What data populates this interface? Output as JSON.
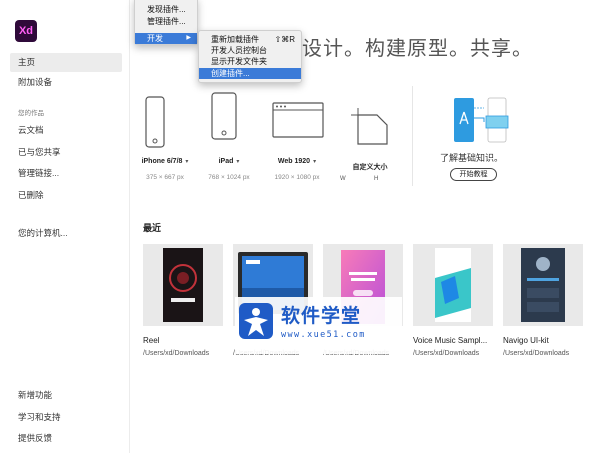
{
  "app": {
    "logo_text": "Xd",
    "logo_bg": "#2f0a3a",
    "logo_fg": "#ff61f6"
  },
  "sidebar": {
    "items": [
      {
        "label": "主页"
      },
      {
        "label": "附加设备"
      }
    ],
    "section_title": "您的作品",
    "work_items": [
      {
        "label": "云文档"
      },
      {
        "label": "已与您共享"
      },
      {
        "label": "管理链接..."
      },
      {
        "label": "已删除"
      }
    ],
    "computer_item": {
      "label": "您的计算机..."
    },
    "bottom_items": [
      {
        "label": "新增功能"
      },
      {
        "label": "学习和支持"
      },
      {
        "label": "提供反馈"
      }
    ]
  },
  "hero": {
    "title_visible": "设计。构建原型。共享。"
  },
  "templates": [
    {
      "label": "iPhone 6/7/8",
      "dims": "375 × 667 px",
      "icon": "phone-icon"
    },
    {
      "label": "iPad",
      "dims": "768 × 1024 px",
      "icon": "tablet-icon"
    },
    {
      "label": "Web 1920",
      "dims": "1920 × 1080 px",
      "icon": "browser-window-icon"
    },
    {
      "label": "自定义大小",
      "w_label": "W",
      "h_label": "H",
      "icon": "custom-size-icon"
    }
  ],
  "learn": {
    "caption": "了解基础知识。",
    "button": "开始教程"
  },
  "recent": {
    "title": "最近",
    "items": [
      {
        "name": "Reel",
        "path": "/Users/xd/Downloads"
      },
      {
        "name": "",
        "path": "/Users/xd/Downloads"
      },
      {
        "name": "",
        "path": "/Users/xd/Downloads"
      },
      {
        "name": "Voice Music Sampl...",
        "path": "/Users/xd/Downloads"
      },
      {
        "name": "Navigo UI-kit",
        "path": "/Users/xd/Downloads"
      }
    ]
  },
  "menus": {
    "plugins": [
      {
        "label": "发现插件..."
      },
      {
        "label": "管理插件..."
      },
      {
        "label": "开发",
        "arrow": "▶"
      }
    ],
    "develop": [
      {
        "label": "重新加载插件",
        "shortcut": "⇧⌘R"
      },
      {
        "label": "开发人员控制台"
      },
      {
        "label": "显示开发文件夹"
      },
      {
        "label": "创建插件..."
      }
    ]
  },
  "watermark": {
    "name": "软件学堂",
    "url": "www.xue51.com"
  },
  "colors": {
    "menu_highlight": "#3b7bd8",
    "accent_blue": "#1f5bc6"
  }
}
